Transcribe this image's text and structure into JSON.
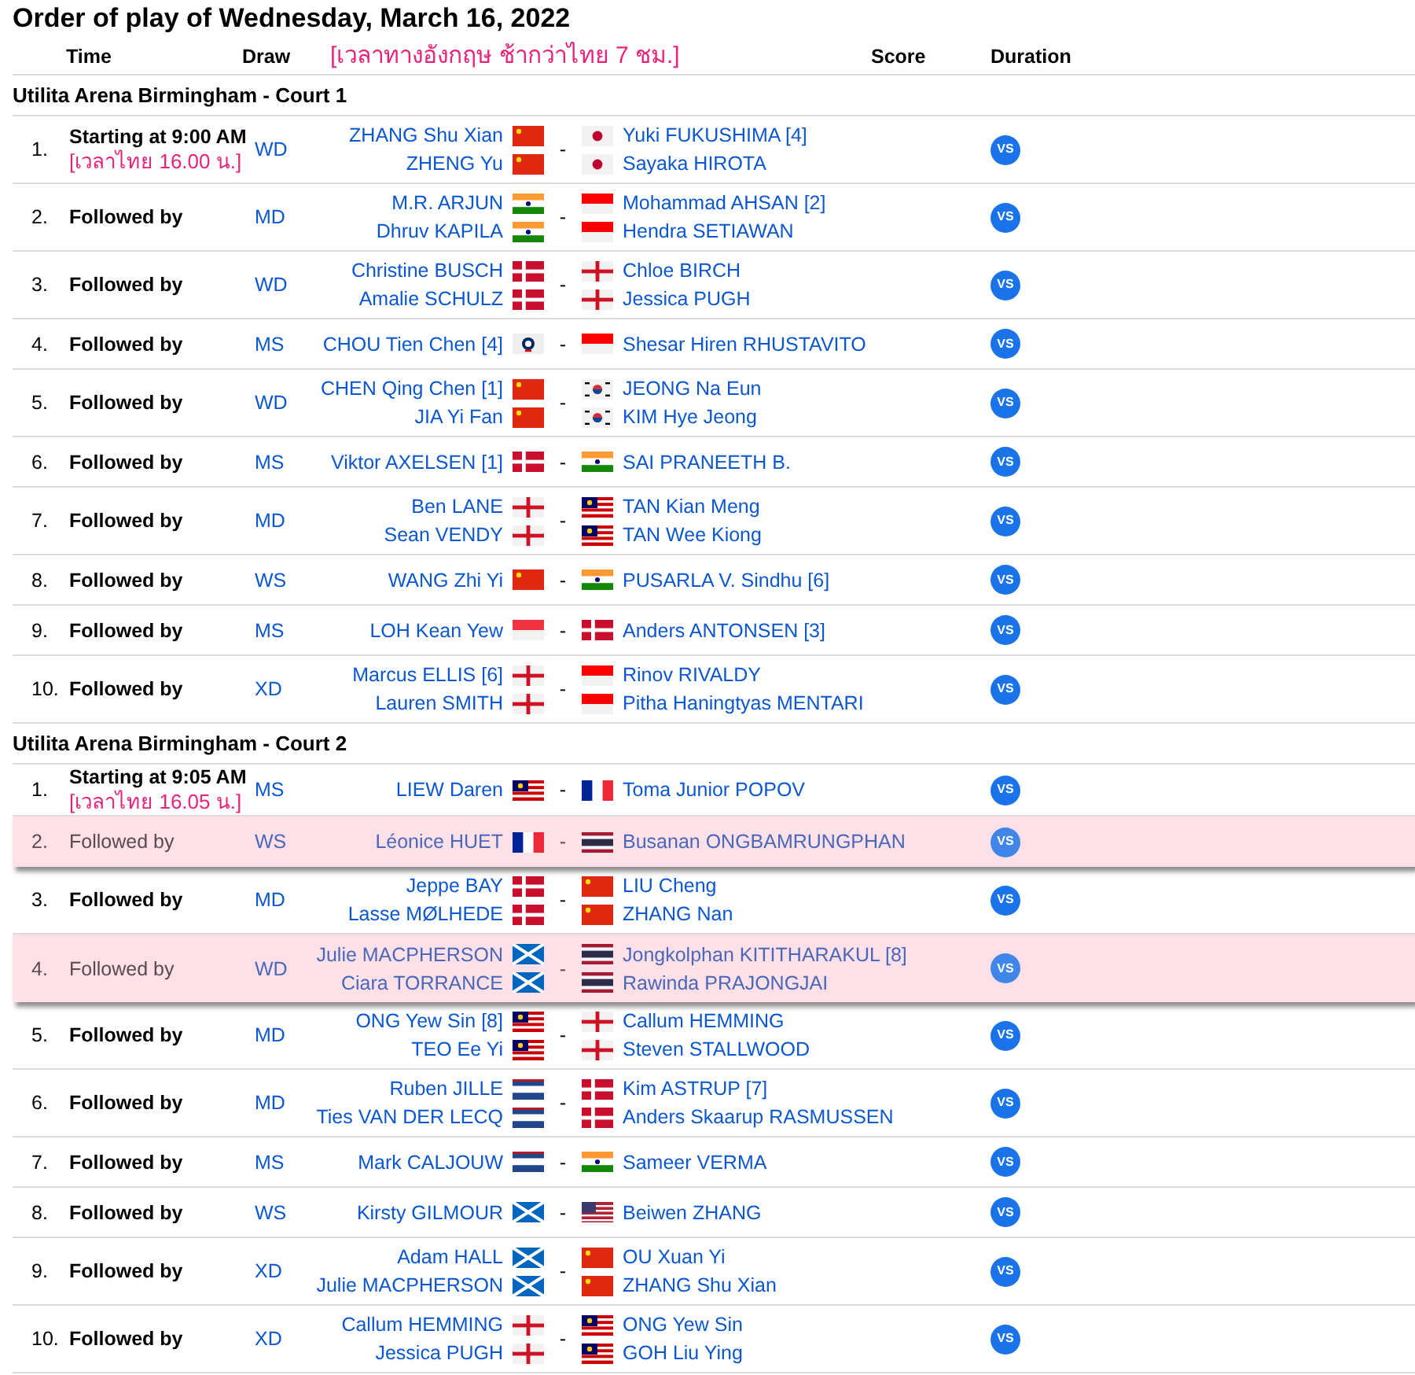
{
  "title": "Order of play of Wednesday, March 16, 2022",
  "header": {
    "time": "Time",
    "draw": "Draw",
    "note": "[เวลาทางอังกฤษ ช้ากว่าไทย 7 ชม.]",
    "score": "Score",
    "duration": "Duration"
  },
  "courts": [
    {
      "name": "Utilita Arena Birmingham - Court 1",
      "matches": [
        {
          "number": "1.",
          "time": "Starting at 9:00 AM",
          "note": "[เวลาไทย 16.00 น.]",
          "draw": "WD",
          "team1": [
            {
              "name": "ZHANG Shu Xian",
              "kind": "china"
            },
            {
              "name": "ZHENG Yu",
              "kind": "china"
            }
          ],
          "separator": "-",
          "team2": [
            {
              "name": "Yuki FUKUSHIMA [4]",
              "kind": "japan"
            },
            {
              "name": "Sayaka HIROTA",
              "kind": "japan"
            }
          ],
          "score": "VS",
          "highlighted": false
        },
        {
          "number": "2.",
          "time": "Followed by",
          "draw": "MD",
          "team1": [
            {
              "name": "M.R. ARJUN",
              "kind": "india"
            },
            {
              "name": "Dhruv KAPILA",
              "kind": "india"
            }
          ],
          "separator": "-",
          "team2": [
            {
              "name": "Mohammad AHSAN [2]",
              "kind": "indonesia"
            },
            {
              "name": "Hendra SETIAWAN",
              "kind": "indonesia"
            }
          ],
          "score": "VS",
          "highlighted": false
        },
        {
          "number": "3.",
          "time": "Followed by",
          "draw": "WD",
          "team1": [
            {
              "name": "Christine BUSCH",
              "kind": "denmark"
            },
            {
              "name": "Amalie SCHULZ",
              "kind": "denmark"
            }
          ],
          "separator": "-",
          "team2": [
            {
              "name": "Chloe BIRCH",
              "kind": "england"
            },
            {
              "name": "Jessica PUGH",
              "kind": "england"
            }
          ],
          "score": "VS",
          "highlighted": false
        },
        {
          "number": "4.",
          "time": "Followed by",
          "draw": "MS",
          "team1": [
            {
              "name": "CHOU Tien Chen [4]",
              "kind": "taipei"
            }
          ],
          "separator": "-",
          "team2": [
            {
              "name": "Shesar Hiren RHUSTAVITO",
              "kind": "indonesia"
            }
          ],
          "score": "VS",
          "highlighted": false
        },
        {
          "number": "5.",
          "time": "Followed by",
          "draw": "WD",
          "team1": [
            {
              "name": "CHEN Qing Chen [1]",
              "kind": "china"
            },
            {
              "name": "JIA Yi Fan",
              "kind": "china"
            }
          ],
          "separator": "-",
          "team2": [
            {
              "name": "JEONG Na Eun",
              "kind": "korea"
            },
            {
              "name": "KIM Hye Jeong",
              "kind": "korea"
            }
          ],
          "score": "VS",
          "highlighted": false
        },
        {
          "number": "6.",
          "time": "Followed by",
          "draw": "MS",
          "team1": [
            {
              "name": "Viktor AXELSEN [1]",
              "kind": "denmark"
            }
          ],
          "separator": "-",
          "team2": [
            {
              "name": "SAI PRANEETH B.",
              "kind": "india"
            }
          ],
          "score": "VS",
          "highlighted": false
        },
        {
          "number": "7.",
          "time": "Followed by",
          "draw": "MD",
          "team1": [
            {
              "name": "Ben LANE",
              "kind": "england"
            },
            {
              "name": "Sean VENDY",
              "kind": "england"
            }
          ],
          "separator": "-",
          "team2": [
            {
              "name": "TAN Kian Meng",
              "kind": "malaysia"
            },
            {
              "name": "TAN Wee Kiong",
              "kind": "malaysia"
            }
          ],
          "score": "VS",
          "highlighted": false
        },
        {
          "number": "8.",
          "time": "Followed by",
          "draw": "WS",
          "team1": [
            {
              "name": "WANG Zhi Yi",
              "kind": "china"
            }
          ],
          "separator": "-",
          "team2": [
            {
              "name": "PUSARLA V. Sindhu [6]",
              "kind": "india"
            }
          ],
          "score": "VS",
          "highlighted": false
        },
        {
          "number": "9.",
          "time": "Followed by",
          "draw": "MS",
          "team1": [
            {
              "name": "LOH Kean Yew",
              "kind": "singapore"
            }
          ],
          "separator": "-",
          "team2": [
            {
              "name": "Anders ANTONSEN [3]",
              "kind": "denmark"
            }
          ],
          "score": "VS",
          "highlighted": false
        },
        {
          "number": "10.",
          "time": "Followed by",
          "draw": "XD",
          "team1": [
            {
              "name": "Marcus ELLIS [6]",
              "kind": "england"
            },
            {
              "name": "Lauren SMITH",
              "kind": "england"
            }
          ],
          "separator": "-",
          "team2": [
            {
              "name": "Rinov RIVALDY",
              "kind": "indonesia"
            },
            {
              "name": "Pitha Haningtyas MENTARI",
              "kind": "indonesia"
            }
          ],
          "score": "VS",
          "highlighted": false
        }
      ]
    },
    {
      "name": "Utilita Arena Birmingham - Court 2",
      "matches": [
        {
          "number": "1.",
          "time": "Starting at 9:05 AM",
          "note": "[เวลาไทย 16.05 น.]",
          "draw": "MS",
          "team1": [
            {
              "name": "LIEW Daren",
              "kind": "malaysia"
            }
          ],
          "separator": "-",
          "team2": [
            {
              "name": "Toma Junior POPOV",
              "kind": "france"
            }
          ],
          "score": "VS",
          "highlighted": false
        },
        {
          "number": "2.",
          "time": "Followed by",
          "draw": "WS",
          "team1": [
            {
              "name": "Léonice HUET",
              "kind": "france"
            }
          ],
          "separator": "-",
          "team2": [
            {
              "name": "Busanan ONGBAMRUNGPHAN",
              "kind": "thailand"
            }
          ],
          "score": "VS",
          "highlighted": true
        },
        {
          "number": "3.",
          "time": "Followed by",
          "draw": "MD",
          "team1": [
            {
              "name": "Jeppe BAY",
              "kind": "denmark"
            },
            {
              "name": "Lasse MØLHEDE",
              "kind": "denmark"
            }
          ],
          "separator": "-",
          "team2": [
            {
              "name": "LIU Cheng",
              "kind": "china"
            },
            {
              "name": "ZHANG Nan",
              "kind": "china"
            }
          ],
          "score": "VS",
          "highlighted": false
        },
        {
          "number": "4.",
          "time": "Followed by",
          "draw": "WD",
          "team1": [
            {
              "name": "Julie MACPHERSON",
              "kind": "scotland"
            },
            {
              "name": "Ciara TORRANCE",
              "kind": "scotland"
            }
          ],
          "separator": "-",
          "team2": [
            {
              "name": "Jongkolphan KITITHARAKUL [8]",
              "kind": "thailand"
            },
            {
              "name": "Rawinda PRAJONGJAI",
              "kind": "thailand"
            }
          ],
          "score": "VS",
          "highlighted": true
        },
        {
          "number": "5.",
          "time": "Followed by",
          "draw": "MD",
          "team1": [
            {
              "name": "ONG Yew Sin [8]",
              "kind": "malaysia"
            },
            {
              "name": "TEO Ee Yi",
              "kind": "malaysia"
            }
          ],
          "separator": "-",
          "team2": [
            {
              "name": "Callum HEMMING",
              "kind": "england"
            },
            {
              "name": "Steven STALLWOOD",
              "kind": "england"
            }
          ],
          "score": "VS",
          "highlighted": false
        },
        {
          "number": "6.",
          "time": "Followed by",
          "draw": "MD",
          "team1": [
            {
              "name": "Ruben JILLE",
              "kind": "netherlands"
            },
            {
              "name": "Ties VAN DER LECQ",
              "kind": "netherlands"
            }
          ],
          "separator": "-",
          "team2": [
            {
              "name": "Kim ASTRUP [7]",
              "kind": "denmark"
            },
            {
              "name": "Anders Skaarup RASMUSSEN",
              "kind": "denmark"
            }
          ],
          "score": "VS",
          "highlighted": false
        },
        {
          "number": "7.",
          "time": "Followed by",
          "draw": "MS",
          "team1": [
            {
              "name": "Mark CALJOUW",
              "kind": "netherlands"
            }
          ],
          "separator": "-",
          "team2": [
            {
              "name": "Sameer VERMA",
              "kind": "india"
            }
          ],
          "score": "VS",
          "highlighted": false
        },
        {
          "number": "8.",
          "time": "Followed by",
          "draw": "WS",
          "team1": [
            {
              "name": "Kirsty GILMOUR",
              "kind": "scotland"
            }
          ],
          "separator": "-",
          "team2": [
            {
              "name": "Beiwen ZHANG",
              "kind": "usa"
            }
          ],
          "score": "VS",
          "highlighted": false
        },
        {
          "number": "9.",
          "time": "Followed by",
          "draw": "XD",
          "team1": [
            {
              "name": "Adam HALL",
              "kind": "scotland"
            },
            {
              "name": "Julie MACPHERSON",
              "kind": "scotland"
            }
          ],
          "separator": "-",
          "team2": [
            {
              "name": "OU Xuan Yi",
              "kind": "china"
            },
            {
              "name": "ZHANG Shu Xian",
              "kind": "china"
            }
          ],
          "score": "VS",
          "highlighted": false
        },
        {
          "number": "10.",
          "time": "Followed by",
          "draw": "XD",
          "team1": [
            {
              "name": "Callum HEMMING",
              "kind": "england"
            },
            {
              "name": "Jessica PUGH",
              "kind": "england"
            }
          ],
          "separator": "-",
          "team2": [
            {
              "name": "ONG Yew Sin",
              "kind": "malaysia"
            },
            {
              "name": "GOH Liu Ying",
              "kind": "malaysia"
            }
          ],
          "score": "VS",
          "highlighted": false
        }
      ]
    }
  ]
}
